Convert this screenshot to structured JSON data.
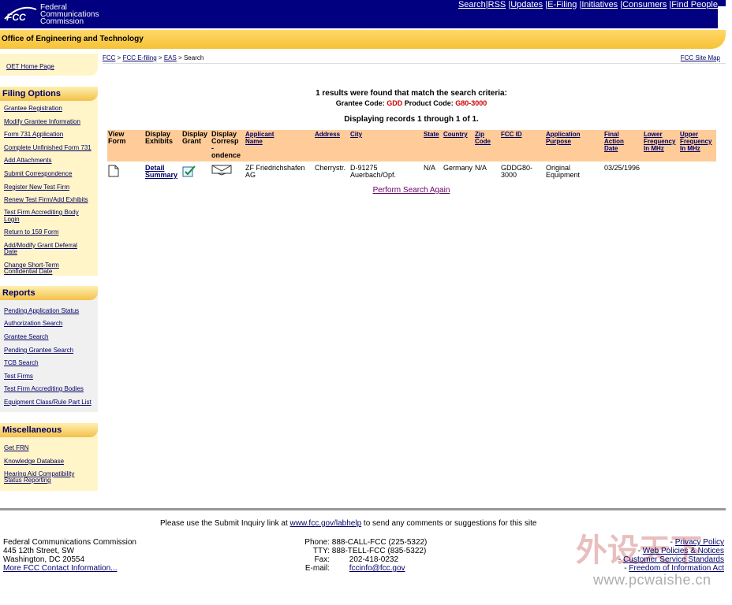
{
  "header": {
    "logo_text": "FCC",
    "agency_line1": "Federal",
    "agency_line2": "Communications",
    "agency_line3": "Commission",
    "nav": [
      "Search",
      "RSS",
      "Updates",
      "E-Filing",
      "Initiatives",
      "Consumers",
      "Find People"
    ],
    "office_title": "Office of Engineering and Technology"
  },
  "sidebar": {
    "home_link": "OET Home Page",
    "filing_options": {
      "title": "Filing Options",
      "items": [
        "Grantee Registration",
        "Modify Grantee Information",
        "Form 731 Application",
        "Complete Unfinished Form 731",
        "Add Attachments",
        "Submit Correspondence",
        "Register New Test Firm",
        "Renew Test Firm/Add Exhibits",
        "Test Firm Accrediting Body",
        "Login",
        "Return to 159 Form",
        "Add/Modify Grant Deferral",
        "Date",
        "Change Short-Term",
        "Confidential Date"
      ]
    },
    "reports": {
      "title": "Reports",
      "items": [
        "Pending Application Status",
        "Authorization Search",
        "Grantee Search",
        "Pending Grantee Search",
        "TCB Search",
        "Test Firms",
        "Test Firm Accrediting Bodies",
        "Equipment Class/Rule Part List"
      ]
    },
    "misc": {
      "title": "Miscellaneous",
      "items": [
        "Get FRN",
        "Knowledge Database",
        "Hearing Aid Compatibility",
        "Status Reporting"
      ]
    }
  },
  "breadcrumb": {
    "items": [
      "FCC",
      "FCC E-filing",
      "EAS"
    ],
    "separator": " > ",
    "current": "Search",
    "site_map": "FCC Site Map"
  },
  "results": {
    "summary": "1 results were found that match the search criteria:",
    "grantee_label": "Grantee Code:",
    "grantee_code": "GDD",
    "product_label": "Product Code:",
    "product_code": "G80-3000",
    "displaying": "Displaying records 1 through 1 of 1.",
    "columns": {
      "view_form": [
        "View",
        "Form"
      ],
      "display_exhibits": [
        "Display",
        "Exhibits"
      ],
      "display_grant": [
        "Display",
        "Grant"
      ],
      "display_corr": [
        "Display",
        "Corresp",
        "-",
        "ondence"
      ],
      "applicant": [
        "Applicant",
        "Name"
      ],
      "address": "Address",
      "city": "City",
      "state": "State",
      "country": "Country",
      "zip": [
        "Zip",
        "Code"
      ],
      "fcc_id": "FCC ID",
      "purpose": [
        "Application",
        "Purpose"
      ],
      "final_date": [
        "Final",
        "Action",
        "Date"
      ],
      "lower_freq": [
        "Lower",
        "Frequency",
        "In MHz"
      ],
      "upper_freq": [
        "Upper",
        "Frequency",
        "In MHz"
      ]
    },
    "row": {
      "detail": [
        "Detail",
        "Summary"
      ],
      "applicant": [
        "ZF Friedrichshafen",
        "AG"
      ],
      "address": "Cherrystr.",
      "city": [
        "D-91275",
        "Auerbach/Opf."
      ],
      "state": "N/A",
      "country": "Germany",
      "zip": "N/A",
      "fcc_id": [
        "GDDG80-",
        "3000"
      ],
      "purpose": [
        "Original",
        "Equipment"
      ],
      "final_date": "03/25/1996",
      "lower_freq": "",
      "upper_freq": ""
    },
    "search_again": "Perform Search Again"
  },
  "footer": {
    "inquiry_pre": "Please use the Submit Inquiry link at ",
    "inquiry_link": "www.fcc.gov/labhelp",
    "inquiry_post": " to send any comments or suggestions for this site",
    "org": "Federal Communications Commission",
    "street": "445 12th Street, SW",
    "city": "Washington, DC 20554",
    "more_contact": "More FCC Contact Information...",
    "phone_label": "Phone:",
    "phone": "888-CALL-FCC (225-5322)",
    "tty_label": "TTY:",
    "tty": "888-TELL-FCC (835-5322)",
    "fax_label": "Fax:",
    "fax": "202-418-0232",
    "email_label": "E-mail:",
    "email": "fccinfo@fcc.gov",
    "policy_links": [
      "Privacy Policy",
      "Web Policies & Notices",
      "Customer Service Standards",
      "Freedom of Information Act"
    ]
  },
  "watermark": {
    "chinese": "外设天下",
    "url": "www.pcwaishe.cn"
  },
  "colors": {
    "header_blue": "#000080",
    "gold": "#f6c236",
    "table_header": "#ffcc99",
    "sidebar_bg": "#fff5c8",
    "highlight_red": "#cc0000"
  }
}
